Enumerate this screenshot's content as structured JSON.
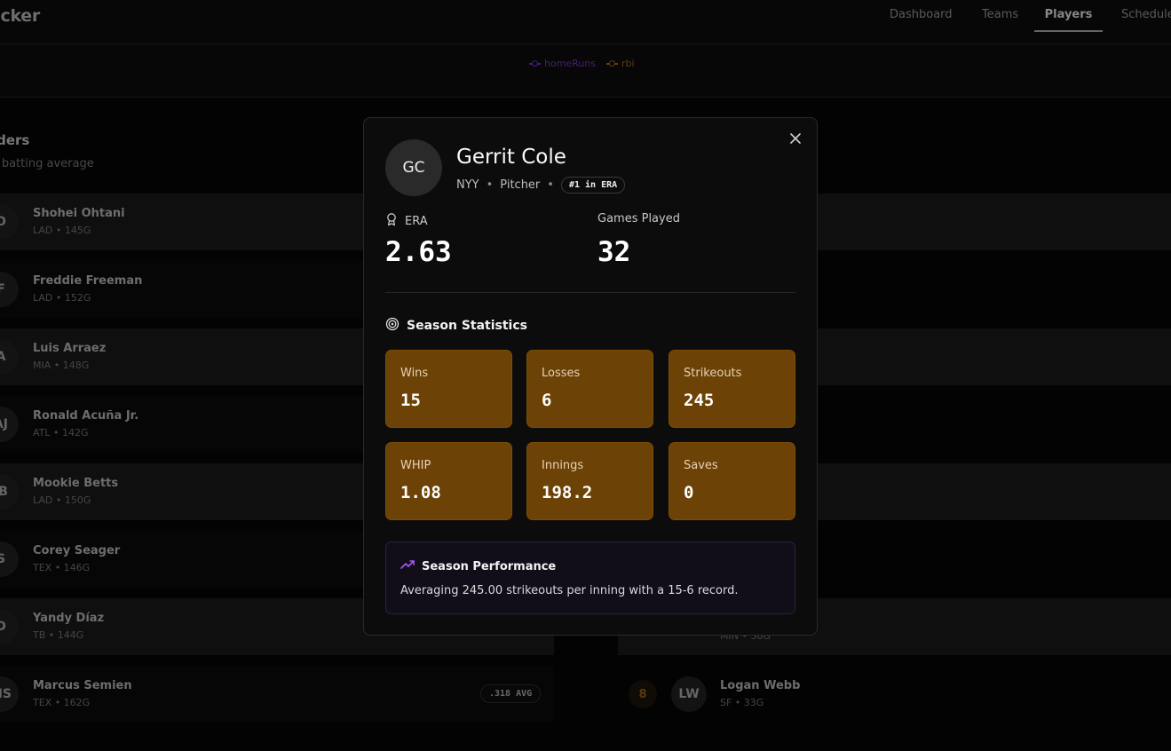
{
  "app": {
    "brand": "acker"
  },
  "nav": {
    "tabs": [
      {
        "label": "Dashboard"
      },
      {
        "label": "Teams"
      },
      {
        "label": "Players"
      },
      {
        "label": "Schedule"
      }
    ],
    "active": "Players"
  },
  "chart_legend": [
    {
      "label": "homeRuns",
      "color": "#6b2fb3"
    },
    {
      "label": "rbi",
      "color": "#9a5a18"
    }
  ],
  "leaders": {
    "title": "aders",
    "subtitle": "y batting average",
    "rows": [
      {
        "initials": "O",
        "name": "Shohei Ohtani",
        "meta": "LAD • 145G"
      },
      {
        "initials": "F",
        "name": "Freddie Freeman",
        "meta": "LAD • 152G"
      },
      {
        "initials": "A",
        "name": "Luis Arraez",
        "meta": "MIA • 148G"
      },
      {
        "initials": "AJ",
        "name": "Ronald Acuña Jr.",
        "meta": "ATL • 142G"
      },
      {
        "initials": "IB",
        "name": "Mookie Betts",
        "meta": "LAD • 150G"
      },
      {
        "initials": "S",
        "name": "Corey Seager",
        "meta": "TEX • 146G"
      },
      {
        "initials": "D",
        "name": "Yandy Díaz",
        "meta": "TB • 144G"
      },
      {
        "initials": "MS",
        "name": "Marcus Semien",
        "meta": "TEX • 162G",
        "stat": ".318 AVG"
      }
    ]
  },
  "pitchers": {
    "visible_rows": [
      {
        "meta": "MIN • 30G"
      },
      {
        "rank": "8",
        "initials": "LW",
        "name": "Logan Webb",
        "meta": "SF • 33G"
      }
    ]
  },
  "modal": {
    "initials": "GC",
    "name": "Gerrit Cole",
    "team": "NYY",
    "position": "Pitcher",
    "badge": "#1 in ERA",
    "highlight_left": {
      "label": "ERA",
      "value": "2.63"
    },
    "highlight_right": {
      "label": "Games Played",
      "value": "32"
    },
    "section_title": "Season Statistics",
    "stats": [
      {
        "label": "Wins",
        "value": "15"
      },
      {
        "label": "Losses",
        "value": "6"
      },
      {
        "label": "Strikeouts",
        "value": "245"
      },
      {
        "label": "WHIP",
        "value": "1.08"
      },
      {
        "label": "Innings",
        "value": "198.2"
      },
      {
        "label": "Saves",
        "value": "0"
      }
    ],
    "performance": {
      "title": "Season Performance",
      "text": "Averaging 245.00 strikeouts per inning with a 15-6 record."
    }
  }
}
